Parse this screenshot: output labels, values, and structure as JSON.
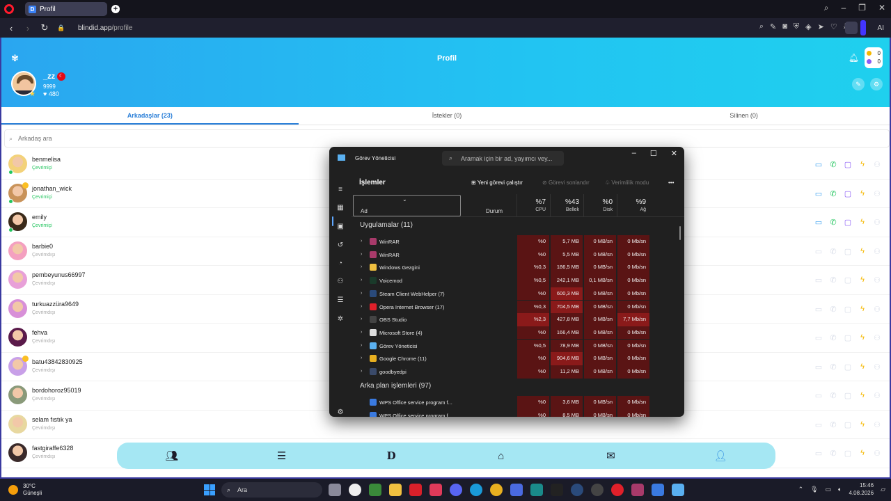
{
  "browser": {
    "tab_title": "Profil",
    "url_domain": "blindid.app",
    "url_path": "/profile",
    "ai_label": "AI"
  },
  "profile": {
    "header_title": "Profil",
    "username": "_zz",
    "subtitle": "9999",
    "likes": "♥ 480",
    "coins_gold": "0",
    "coins_purple": "0"
  },
  "tabs": [
    {
      "label": "Arkadaşlar (23)"
    },
    {
      "label": "İstekler (0)"
    },
    {
      "label": "Silinen (0)"
    }
  ],
  "search": {
    "placeholder": "Arkadaş ara"
  },
  "friends": [
    {
      "name": "benmelisa",
      "status": "Çevrimiçi",
      "online": true,
      "color": "#f3d27a"
    },
    {
      "name": "jonathan_wick",
      "status": "Çevrimiçi",
      "online": true,
      "color": "#c9935a"
    },
    {
      "name": "emily",
      "status": "Çevrimiçi",
      "online": true,
      "color": "#3a2a1a"
    },
    {
      "name": "barbie0",
      "status": "Çevrimdışı",
      "online": false,
      "color": "#f4a0c0"
    },
    {
      "name": "pembeyunus66997",
      "status": "Çevrimdışı",
      "online": false,
      "color": "#e8a0d8"
    },
    {
      "name": "turkuazzüra9649",
      "status": "Çevrimdışı",
      "online": false,
      "color": "#d890d8"
    },
    {
      "name": "fehva",
      "status": "Çevrimdışı",
      "online": false,
      "color": "#5a1a4a"
    },
    {
      "name": "batu43842830925",
      "status": "Çevrimdışı",
      "online": false,
      "color": "#c8a0e8"
    },
    {
      "name": "bordohoroz95019",
      "status": "Çevrimdışı",
      "online": false,
      "color": "#8a9a7a"
    },
    {
      "name": "selam fıstık ya",
      "status": "Çevrimdışı",
      "online": false,
      "color": "#e8d8a0"
    },
    {
      "name": "fastgiraffe6328",
      "status": "Çevrimdışı",
      "online": false,
      "color": "#3a2a2a"
    }
  ],
  "task_manager": {
    "title": "Görev Yöneticisi",
    "search_placeholder": "Aramak için bir ad, yayımcı vey...",
    "heading": "İşlemler",
    "new_task": "Yeni görevi çalıştır",
    "end_task": "Görevi sonlandır",
    "efficiency": "Verimlilik modu",
    "more": "•••",
    "columns": {
      "name": "Ad",
      "status": "Durum",
      "cpu_pct": "%7",
      "cpu": "CPU",
      "mem_pct": "%43",
      "mem": "Bellek",
      "disk_pct": "%0",
      "disk": "Disk",
      "net_pct": "%9",
      "net": "Ağ"
    },
    "apps_section": "Uygulamalar (11)",
    "bg_section": "Arka plan işlemleri (97)",
    "apps": [
      {
        "name": "WinRAR",
        "cpu": "%0",
        "mem": "5,7 MB",
        "disk": "0 MB/sn",
        "net": "0 Mb/sn",
        "leaf": false,
        "icolor": "#a83a6a"
      },
      {
        "name": "WinRAR",
        "cpu": "%0",
        "mem": "5,5 MB",
        "disk": "0 MB/sn",
        "net": "0 Mb/sn",
        "leaf": false,
        "icolor": "#a83a6a"
      },
      {
        "name": "Windows Gezgini",
        "cpu": "%0,3",
        "mem": "186,5 MB",
        "disk": "0 MB/sn",
        "net": "0 Mb/sn",
        "leaf": false,
        "icolor": "#f0c040"
      },
      {
        "name": "Voicemod",
        "cpu": "%0,5",
        "mem": "242,1 MB",
        "disk": "0,1 MB/sn",
        "net": "0 Mb/sn",
        "leaf": false,
        "icolor": "#1a3a2a"
      },
      {
        "name": "Steam Client WebHelper (7)",
        "cpu": "%0",
        "mem": "600,3 MB",
        "disk": "0 MB/sn",
        "net": "0 Mb/sn",
        "leaf": true,
        "icolor": "#2a4a7a"
      },
      {
        "name": "Opera Internet Browser (17)",
        "cpu": "%0,3",
        "mem": "704,5 MB",
        "disk": "0 MB/sn",
        "net": "0 Mb/sn",
        "leaf": true,
        "icolor": "#e0202a"
      },
      {
        "name": "OBS Studio",
        "cpu": "%2,3",
        "mem": "427,8 MB",
        "disk": "0 MB/sn",
        "net": "7,7 Mb/sn",
        "leaf": false,
        "icolor": "#444"
      },
      {
        "name": "Microsoft Store (4)",
        "cpu": "%0",
        "mem": "166,4 MB",
        "disk": "0 MB/sn",
        "net": "0 Mb/sn",
        "leaf": false,
        "icolor": "#ddd"
      },
      {
        "name": "Görev Yöneticisi",
        "cpu": "%0,5",
        "mem": "78,9 MB",
        "disk": "0 MB/sn",
        "net": "0 Mb/sn",
        "leaf": false,
        "icolor": "#5ab0f0"
      },
      {
        "name": "Google Chrome (11)",
        "cpu": "%0",
        "mem": "904,6 MB",
        "disk": "0 MB/sn",
        "net": "0 Mb/sn",
        "leaf": true,
        "icolor": "#e8b020"
      },
      {
        "name": "goodbyedpi",
        "cpu": "%0",
        "mem": "11,2 MB",
        "disk": "0 MB/sn",
        "net": "0 Mb/sn",
        "leaf": false,
        "icolor": "#3a4a6a"
      }
    ],
    "bg": [
      {
        "name": "WPS Office service program f...",
        "cpu": "%0",
        "mem": "3,6 MB",
        "disk": "0 MB/sn",
        "net": "0 Mb/sn",
        "icolor": "#3a7ae0"
      },
      {
        "name": "WPS Office service program f...",
        "cpu": "%0",
        "mem": "8,5 MB",
        "disk": "0 MB/sn",
        "net": "0 Mb/sn",
        "icolor": "#3a7ae0"
      }
    ]
  },
  "taskbar": {
    "temp": "30°C",
    "weather": "Güneşli",
    "search": "Ara",
    "time": "15:46",
    "date": "4.08.2026"
  }
}
